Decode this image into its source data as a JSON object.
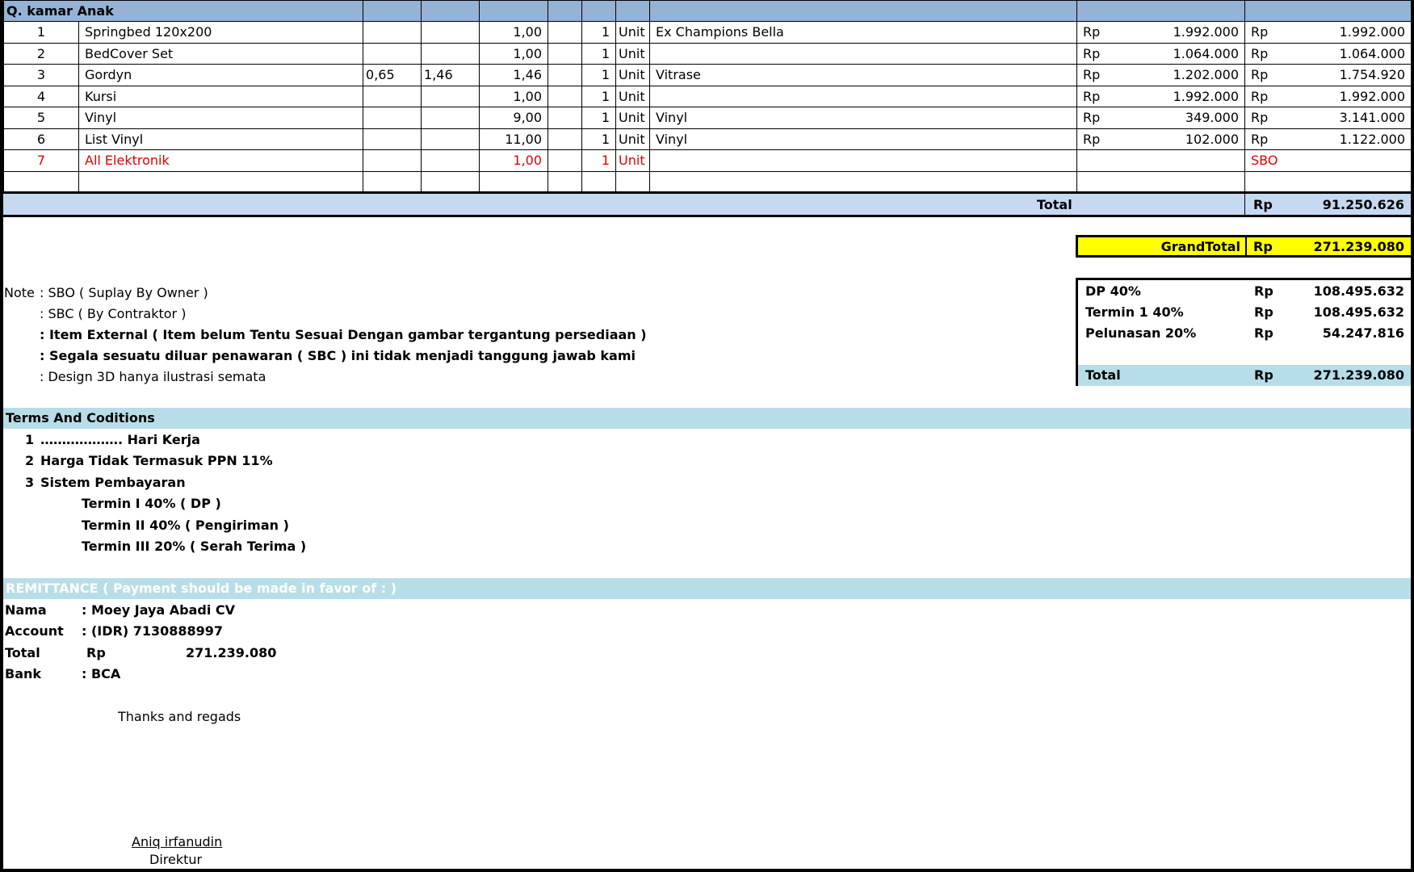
{
  "section_title": "Q. kamar Anak",
  "items": [
    {
      "no": "1",
      "name": "Springbed 120x200",
      "w": "",
      "l": "",
      "qty": "1,00",
      "n": "1",
      "unit": "Unit",
      "desc": "Ex Champions Bella",
      "rp1": "Rp",
      "price": "1.992.000",
      "rp2": "Rp",
      "total": "1.992.000"
    },
    {
      "no": "2",
      "name": "BedCover Set",
      "w": "",
      "l": "",
      "qty": "1,00",
      "n": "1",
      "unit": "Unit",
      "desc": "",
      "rp1": "Rp",
      "price": "1.064.000",
      "rp2": "Rp",
      "total": "1.064.000"
    },
    {
      "no": "3",
      "name": "Gordyn",
      "w": "0,65",
      "l": "1,46",
      "qty": "1,46",
      "n": "1",
      "unit": "Unit",
      "desc": "Vitrase",
      "rp1": "Rp",
      "price": "1.202.000",
      "rp2": "Rp",
      "total": "1.754.920"
    },
    {
      "no": "4",
      "name": "Kursi",
      "w": "",
      "l": "",
      "qty": "1,00",
      "n": "1",
      "unit": "Unit",
      "desc": "",
      "rp1": "Rp",
      "price": "1.992.000",
      "rp2": "Rp",
      "total": "1.992.000"
    },
    {
      "no": "5",
      "name": "Vinyl",
      "w": "",
      "l": "",
      "qty": "9,00",
      "n": "1",
      "unit": "Unit",
      "desc": "Vinyl",
      "rp1": "Rp",
      "price": "349.000",
      "rp2": "Rp",
      "total": "3.141.000"
    },
    {
      "no": "6",
      "name": "List Vinyl",
      "w": "",
      "l": "",
      "qty": "11,00",
      "n": "1",
      "unit": "Unit",
      "desc": "Vinyl",
      "rp1": "Rp",
      "price": "102.000",
      "rp2": "Rp",
      "total": "1.122.000"
    },
    {
      "no": "7",
      "name": "All Elektronik",
      "w": "",
      "l": "",
      "qty": "1,00",
      "n": "1",
      "unit": "Unit",
      "desc": "",
      "rp1": "",
      "price": "",
      "rp2": "SBO",
      "total": ""
    }
  ],
  "section_total": {
    "label": "Total",
    "currency": "Rp",
    "value": "91.250.626"
  },
  "grand_total": {
    "label": "GrandTotal",
    "currency": "Rp",
    "value": "271.239.080"
  },
  "notes": {
    "prefix": "Note",
    "lines": [
      ": SBO ( Suplay By Owner )",
      ": SBC  ( By Contraktor )",
      ": Item External ( Item belum Tentu Sesuai Dengan gambar tergantung persediaan )",
      ": Segala sesuatu diluar penawaran ( SBC ) ini tidak menjadi tanggung jawab kami",
      ": Design 3D hanya ilustrasi semata"
    ]
  },
  "payment_schedule": [
    {
      "label": "DP 40%",
      "currency": "Rp",
      "value": "108.495.632"
    },
    {
      "label": "Termin 1 40%",
      "currency": "Rp",
      "value": "108.495.632"
    },
    {
      "label": "Pelunasan 20%",
      "currency": "Rp",
      "value": "54.247.816"
    },
    {
      "label": "Total",
      "currency": "Rp",
      "value": "271.239.080"
    }
  ],
  "terms": {
    "title": "Terms And Coditions",
    "items": [
      {
        "no": "1",
        "text": "………………. Hari Kerja"
      },
      {
        "no": "2",
        "text": "Harga Tidak Termasuk PPN 11%"
      },
      {
        "no": "3",
        "text": "Sistem Pembayaran"
      }
    ],
    "sub": [
      "Termin I 40% ( DP )",
      "Termin II 40% ( Pengiriman )",
      "Termin III 20% ( Serah Terima )"
    ]
  },
  "remittance": {
    "title": "REMITTANCE ( Payment should be made in favor of : )",
    "nama_label": "Nama",
    "nama_value": ": Moey Jaya Abadi CV",
    "account_label": "Account",
    "account_value": ": (IDR) 7130888997",
    "total_label": "Total",
    "total_currency": "Rp",
    "total_value": "271.239.080",
    "bank_label": "Bank",
    "bank_value": ": BCA"
  },
  "closing": "Thanks and regads",
  "signatory": {
    "name": "Aniq irfanudin",
    "title": "Direktur"
  },
  "colors": {
    "header": "#95b3d7",
    "total_band": "#c5d9f1",
    "grand_total": "#ffff00",
    "section_band": "#b7dee8",
    "highlight_text": "#e00000"
  }
}
